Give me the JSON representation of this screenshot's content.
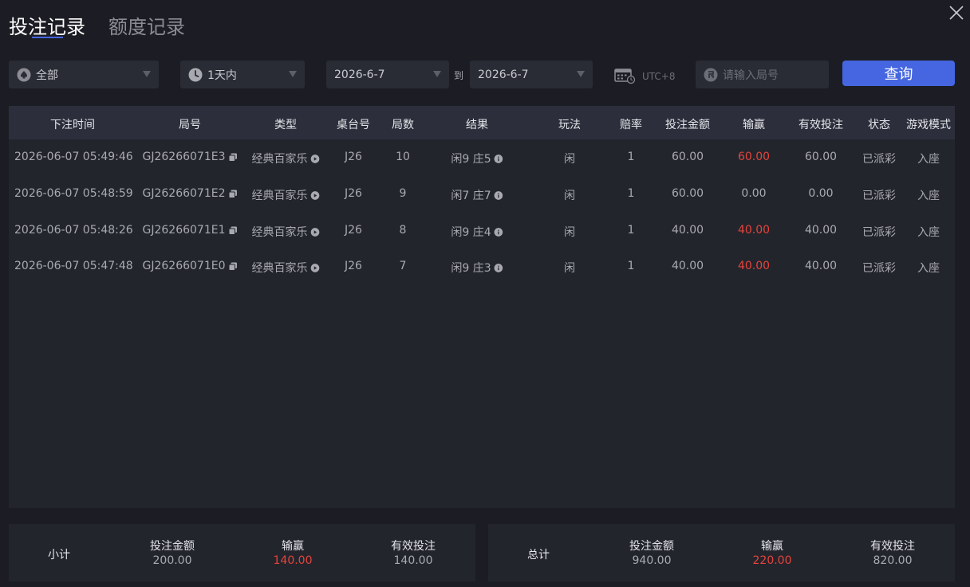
{
  "tabs": [
    {
      "label": "投注记录",
      "active": true
    },
    {
      "label": "额度记录",
      "active": false
    }
  ],
  "filters": {
    "type_value": "全部",
    "range_value": "1天内",
    "date_start": "2026-6-7",
    "to_label": "到",
    "date_end": "2026-6-7",
    "timezone": "UTC+8",
    "round_placeholder": "请输入局号",
    "query_label": "查询"
  },
  "table": {
    "headers": [
      "下注时间",
      "局号",
      "类型",
      "桌台号",
      "局数",
      "结果",
      "玩法",
      "赔率",
      "投注金额",
      "输赢",
      "有效投注",
      "状态",
      "游戏模式"
    ],
    "rows": [
      {
        "time": "2026-06-07 05:49:46",
        "round": "GJ26266071E3",
        "type": "经典百家乐",
        "table": "J26",
        "count": "10",
        "result": "闲9 庄5",
        "play": "闲",
        "odds": "1",
        "bet": "60.00",
        "winloss": "60.00",
        "winloss_red": true,
        "valid": "60.00",
        "status": "已派彩",
        "mode": "入座"
      },
      {
        "time": "2026-06-07 05:48:59",
        "round": "GJ26266071E2",
        "type": "经典百家乐",
        "table": "J26",
        "count": "9",
        "result": "闲7 庄7",
        "play": "闲",
        "odds": "1",
        "bet": "60.00",
        "winloss": "0.00",
        "winloss_red": false,
        "valid": "0.00",
        "status": "已派彩",
        "mode": "入座"
      },
      {
        "time": "2026-06-07 05:48:26",
        "round": "GJ26266071E1",
        "type": "经典百家乐",
        "table": "J26",
        "count": "8",
        "result": "闲9 庄4",
        "play": "闲",
        "odds": "1",
        "bet": "40.00",
        "winloss": "40.00",
        "winloss_red": true,
        "valid": "40.00",
        "status": "已派彩",
        "mode": "入座"
      },
      {
        "time": "2026-06-07 05:47:48",
        "round": "GJ26266071E0",
        "type": "经典百家乐",
        "table": "J26",
        "count": "7",
        "result": "闲9 庄3",
        "play": "闲",
        "odds": "1",
        "bet": "40.00",
        "winloss": "40.00",
        "winloss_red": true,
        "valid": "40.00",
        "status": "已派彩",
        "mode": "入座"
      }
    ]
  },
  "subtotal": {
    "label": "小计",
    "bet_label": "投注金额",
    "bet": "200.00",
    "winloss_label": "输赢",
    "winloss": "140.00",
    "valid_label": "有效投注",
    "valid": "140.00"
  },
  "total": {
    "label": "总计",
    "bet_label": "投注金额",
    "bet": "940.00",
    "winloss_label": "输赢",
    "winloss": "220.00",
    "valid_label": "有效投注",
    "valid": "820.00"
  },
  "icons": {
    "spade": "spade-icon",
    "clock": "clock-icon",
    "calendar": "calendar-icon",
    "round": "round-icon",
    "copy": "copy-icon",
    "play": "play-icon",
    "info": "info-icon",
    "close": "close-icon"
  },
  "colors": {
    "accent": "#4566e0",
    "win": "#e5443a",
    "background": "#1c1d24",
    "panel": "#23252d",
    "header": "#2c2f3b"
  }
}
